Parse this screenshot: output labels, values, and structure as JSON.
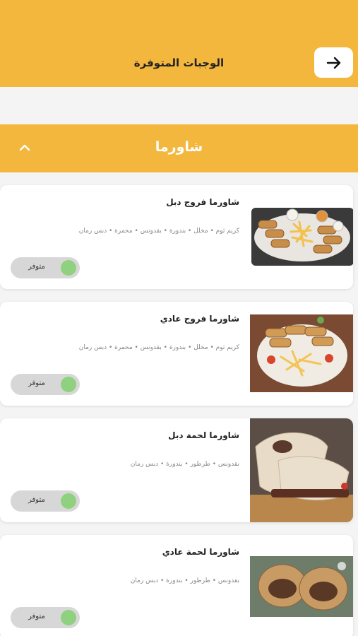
{
  "header": {
    "title": "الوجبات المتوفرة",
    "back_icon": "arrow-right-icon"
  },
  "section": {
    "title": "شاورما",
    "toggle_icon": "chevron-up-icon"
  },
  "colors": {
    "accent": "#f4b73e",
    "toggle_on": "#8fd17e",
    "toggle_track": "#d7d7d7"
  },
  "meals": [
    {
      "name": "شاورما فروج دبل",
      "ingredients": "كريم ثوم • مخلل • بندورة • بقدونس • محمرة • دبس رمان",
      "status": "متوفر",
      "available": true,
      "image": "chicken-shawarma-platter-image"
    },
    {
      "name": "شاورما فروج عادي",
      "ingredients": "كريم ثوم • مخلل • بندورة • بقدونس • محمرة • دبس رمان",
      "status": "متوفر",
      "available": true,
      "image": "chicken-shawarma-plate-image"
    },
    {
      "name": "شاورما لحمة دبل",
      "ingredients": "بقدونس • طرطور • بندورة • دبس رمان",
      "status": "متوفر",
      "available": true,
      "image": "meat-shawarma-wrap-image"
    },
    {
      "name": "شاورما لحمة عادي",
      "ingredients": "بقدونس • طرطور • بندورة • دبس رمان",
      "status": "متوفر",
      "available": true,
      "image": "meat-shawarma-roll-image"
    }
  ]
}
